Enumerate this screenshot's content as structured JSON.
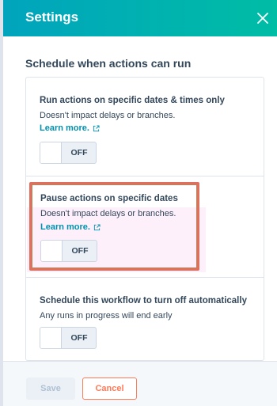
{
  "header": {
    "title": "Settings",
    "close_icon": "close-icon"
  },
  "schedule": {
    "section_title": "Schedule when actions can run",
    "cards": [
      {
        "title": "Run actions on specific dates & times only",
        "description": "Doesn't impact delays or branches.",
        "learn_more": "Learn more.",
        "toggle": "OFF"
      },
      {
        "title": "Pause actions on specific dates",
        "description": "Doesn't impact delays or branches.",
        "learn_more": "Learn more.",
        "toggle": "OFF"
      },
      {
        "title": "Schedule this workflow to turn off automatically",
        "description": "Any runs in progress will end early",
        "toggle": "OFF"
      }
    ]
  },
  "footer": {
    "save_label": "Save",
    "cancel_label": "Cancel"
  },
  "colors": {
    "header_gradient_start": "#00a4bd",
    "header_gradient_end": "#00bda5",
    "link": "#0091ae",
    "cancel_accent": "#ff7a59",
    "highlight_border": "#e0705d"
  }
}
